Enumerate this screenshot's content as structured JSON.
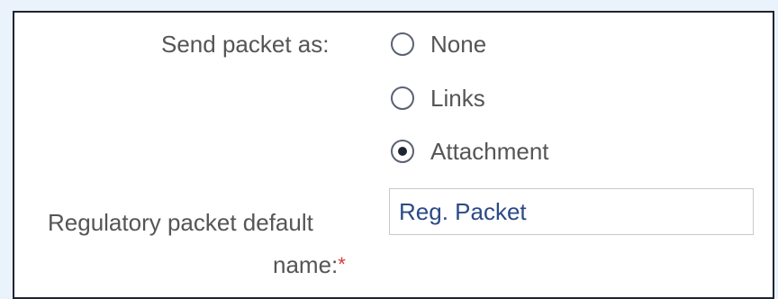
{
  "send_packet": {
    "label": "Send packet as:",
    "options": [
      {
        "label": "None",
        "selected": false
      },
      {
        "label": "Links",
        "selected": false
      },
      {
        "label": "Attachment",
        "selected": true
      }
    ]
  },
  "default_name": {
    "label_line1": "Regulatory packet default",
    "label_line2": "name:",
    "required_marker": "*",
    "value": "Reg. Packet"
  }
}
